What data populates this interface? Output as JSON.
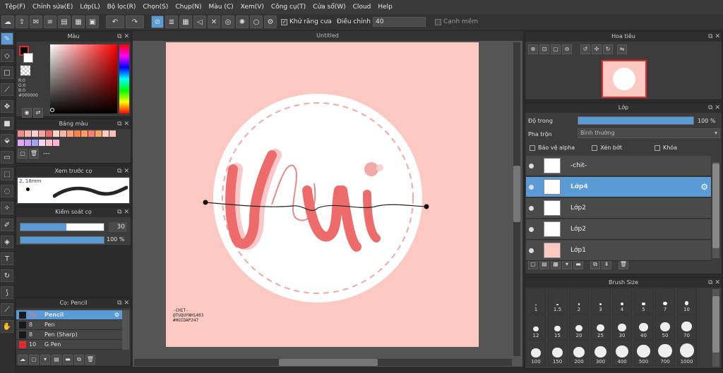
{
  "menu": [
    "Tệp(F)",
    "Chỉnh sửa(E)",
    "Lớp(L)",
    "Bộ lọc(R)",
    "Chọn(S)",
    "Chụp(N)",
    "Màu (C)",
    "Xem(V)",
    "Công cụ(T)",
    "Cửa sổ(W)",
    "Cloud",
    "Help"
  ],
  "toolbar": {
    "antialias": "Khử răng cưa",
    "adjust_label": "Điều chỉnh",
    "adjust_value": "40",
    "smooth": "Cạnh mềm"
  },
  "color_panel": {
    "title": "Màu",
    "r": "R:0",
    "g": "G:0",
    "b": "B:0",
    "hex": "#000000"
  },
  "palette_panel": {
    "title": "Bảng màu",
    "swatches": [
      "#f28c8c",
      "#f7b6b6",
      "#f9cfcf",
      "#f6a3a3",
      "#e86a6a",
      "#ffd7c4",
      "#fbb5a6",
      "#ffa07a",
      "#ff7f50",
      "#ff9966",
      "#fa8072",
      "#f4a460",
      "#fad0c4",
      "#f6c1b5",
      "#e3a6ff",
      "#c9a0ff",
      "#a3a3f7",
      "#f0d7ff",
      "#ffc0cb",
      "#ffb3d9"
    ],
    "name_field": "---"
  },
  "preview_panel": {
    "title": "Xem trước cọ",
    "size": "2. 18mm"
  },
  "control_panel": {
    "title": "Kiểm soát cọ",
    "size_value": "30",
    "opacity_value": "100 %",
    "size_fill": 0.55,
    "opacity_fill": 1.0
  },
  "brush_panel": {
    "title": "Cọ: Pencil",
    "items": [
      {
        "size": "30",
        "name": "Pencil",
        "color": "#1a1a1a",
        "selected": true
      },
      {
        "size": "8",
        "name": "Pen",
        "color": "#1a1a1a",
        "selected": false
      },
      {
        "size": "8",
        "name": "Pen (Sharp)",
        "color": "#1a1a1a",
        "selected": false
      },
      {
        "size": "10",
        "name": "G Pen",
        "color": "#e32b2b",
        "selected": false
      }
    ]
  },
  "canvas": {
    "doc_title": "Untitled",
    "credit": [
      "-CHIT-",
      "@TUQUYNH1403",
      "#HOIDAP247"
    ]
  },
  "navigator": {
    "title": "Hoa tiêu"
  },
  "layer_panel": {
    "title": "Lớp",
    "opacity_label": "Độ trong",
    "opacity_value": "100 %",
    "opacity_fill": 1.0,
    "blend_label": "Pha trộn",
    "blend_value": "Bình thường",
    "protect_alpha": "Bảo vệ alpha",
    "clip": "Xén bớt",
    "lock": "Khóa",
    "layers": [
      {
        "name": "-chit-",
        "selected": false
      },
      {
        "name": "Lớp4",
        "selected": true
      },
      {
        "name": "Lớp2",
        "selected": false
      },
      {
        "name": "Lớp2",
        "selected": false
      },
      {
        "name": "Lớp1",
        "selected": false
      }
    ]
  },
  "brush_size_panel": {
    "title": "Brush Size",
    "sizes": [
      "1",
      "1.5",
      "2",
      "3",
      "4",
      "5",
      "7",
      "10",
      "12",
      "15",
      "20",
      "25",
      "30",
      "40",
      "50",
      "70",
      "100",
      "150",
      "200",
      "300",
      "400",
      "500",
      "700",
      "1000"
    ]
  }
}
